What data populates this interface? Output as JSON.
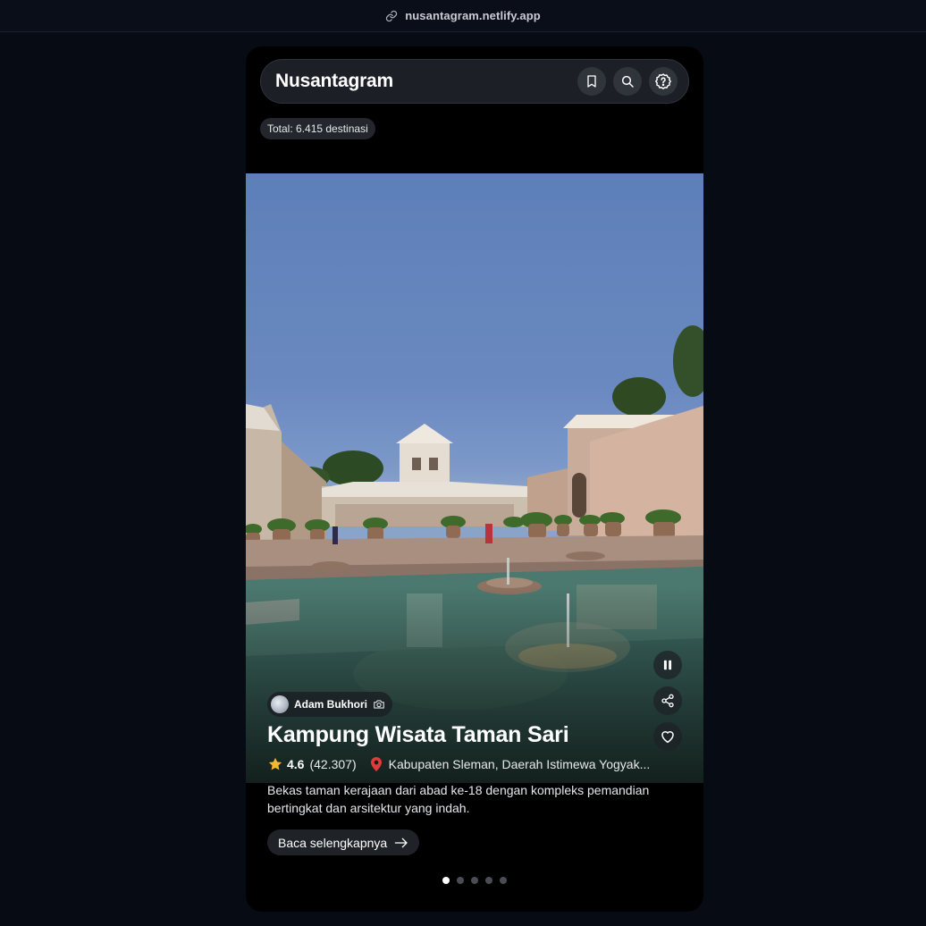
{
  "browser": {
    "url": "nusantagram.netlify.app"
  },
  "header": {
    "brand": "Nusantagram",
    "icons": [
      "bookmark-icon",
      "search-icon",
      "help-settings-icon"
    ]
  },
  "total_badge": "Total: 6.415 destinasi",
  "post": {
    "author": "Adam Bukhori",
    "title": "Kampung Wisata Taman Sari",
    "rating": "4.6",
    "reviews": "(42.307)",
    "location": "Kabupaten Sleman, Daerah Istimewa Yogyak...",
    "description": "Bekas taman kerajaan dari abad ke-18 dengan kompleks pemandian bertingkat dan arsitektur yang indah.",
    "read_more": "Baca selengkapnya",
    "actions": [
      "pause-icon",
      "share-icon",
      "heart-icon"
    ]
  },
  "carousel": {
    "count": 5,
    "active_index": 0
  },
  "colors": {
    "background": "#070b14",
    "card": "#000000",
    "star": "#f5b731",
    "pin": "#e03a3a"
  }
}
